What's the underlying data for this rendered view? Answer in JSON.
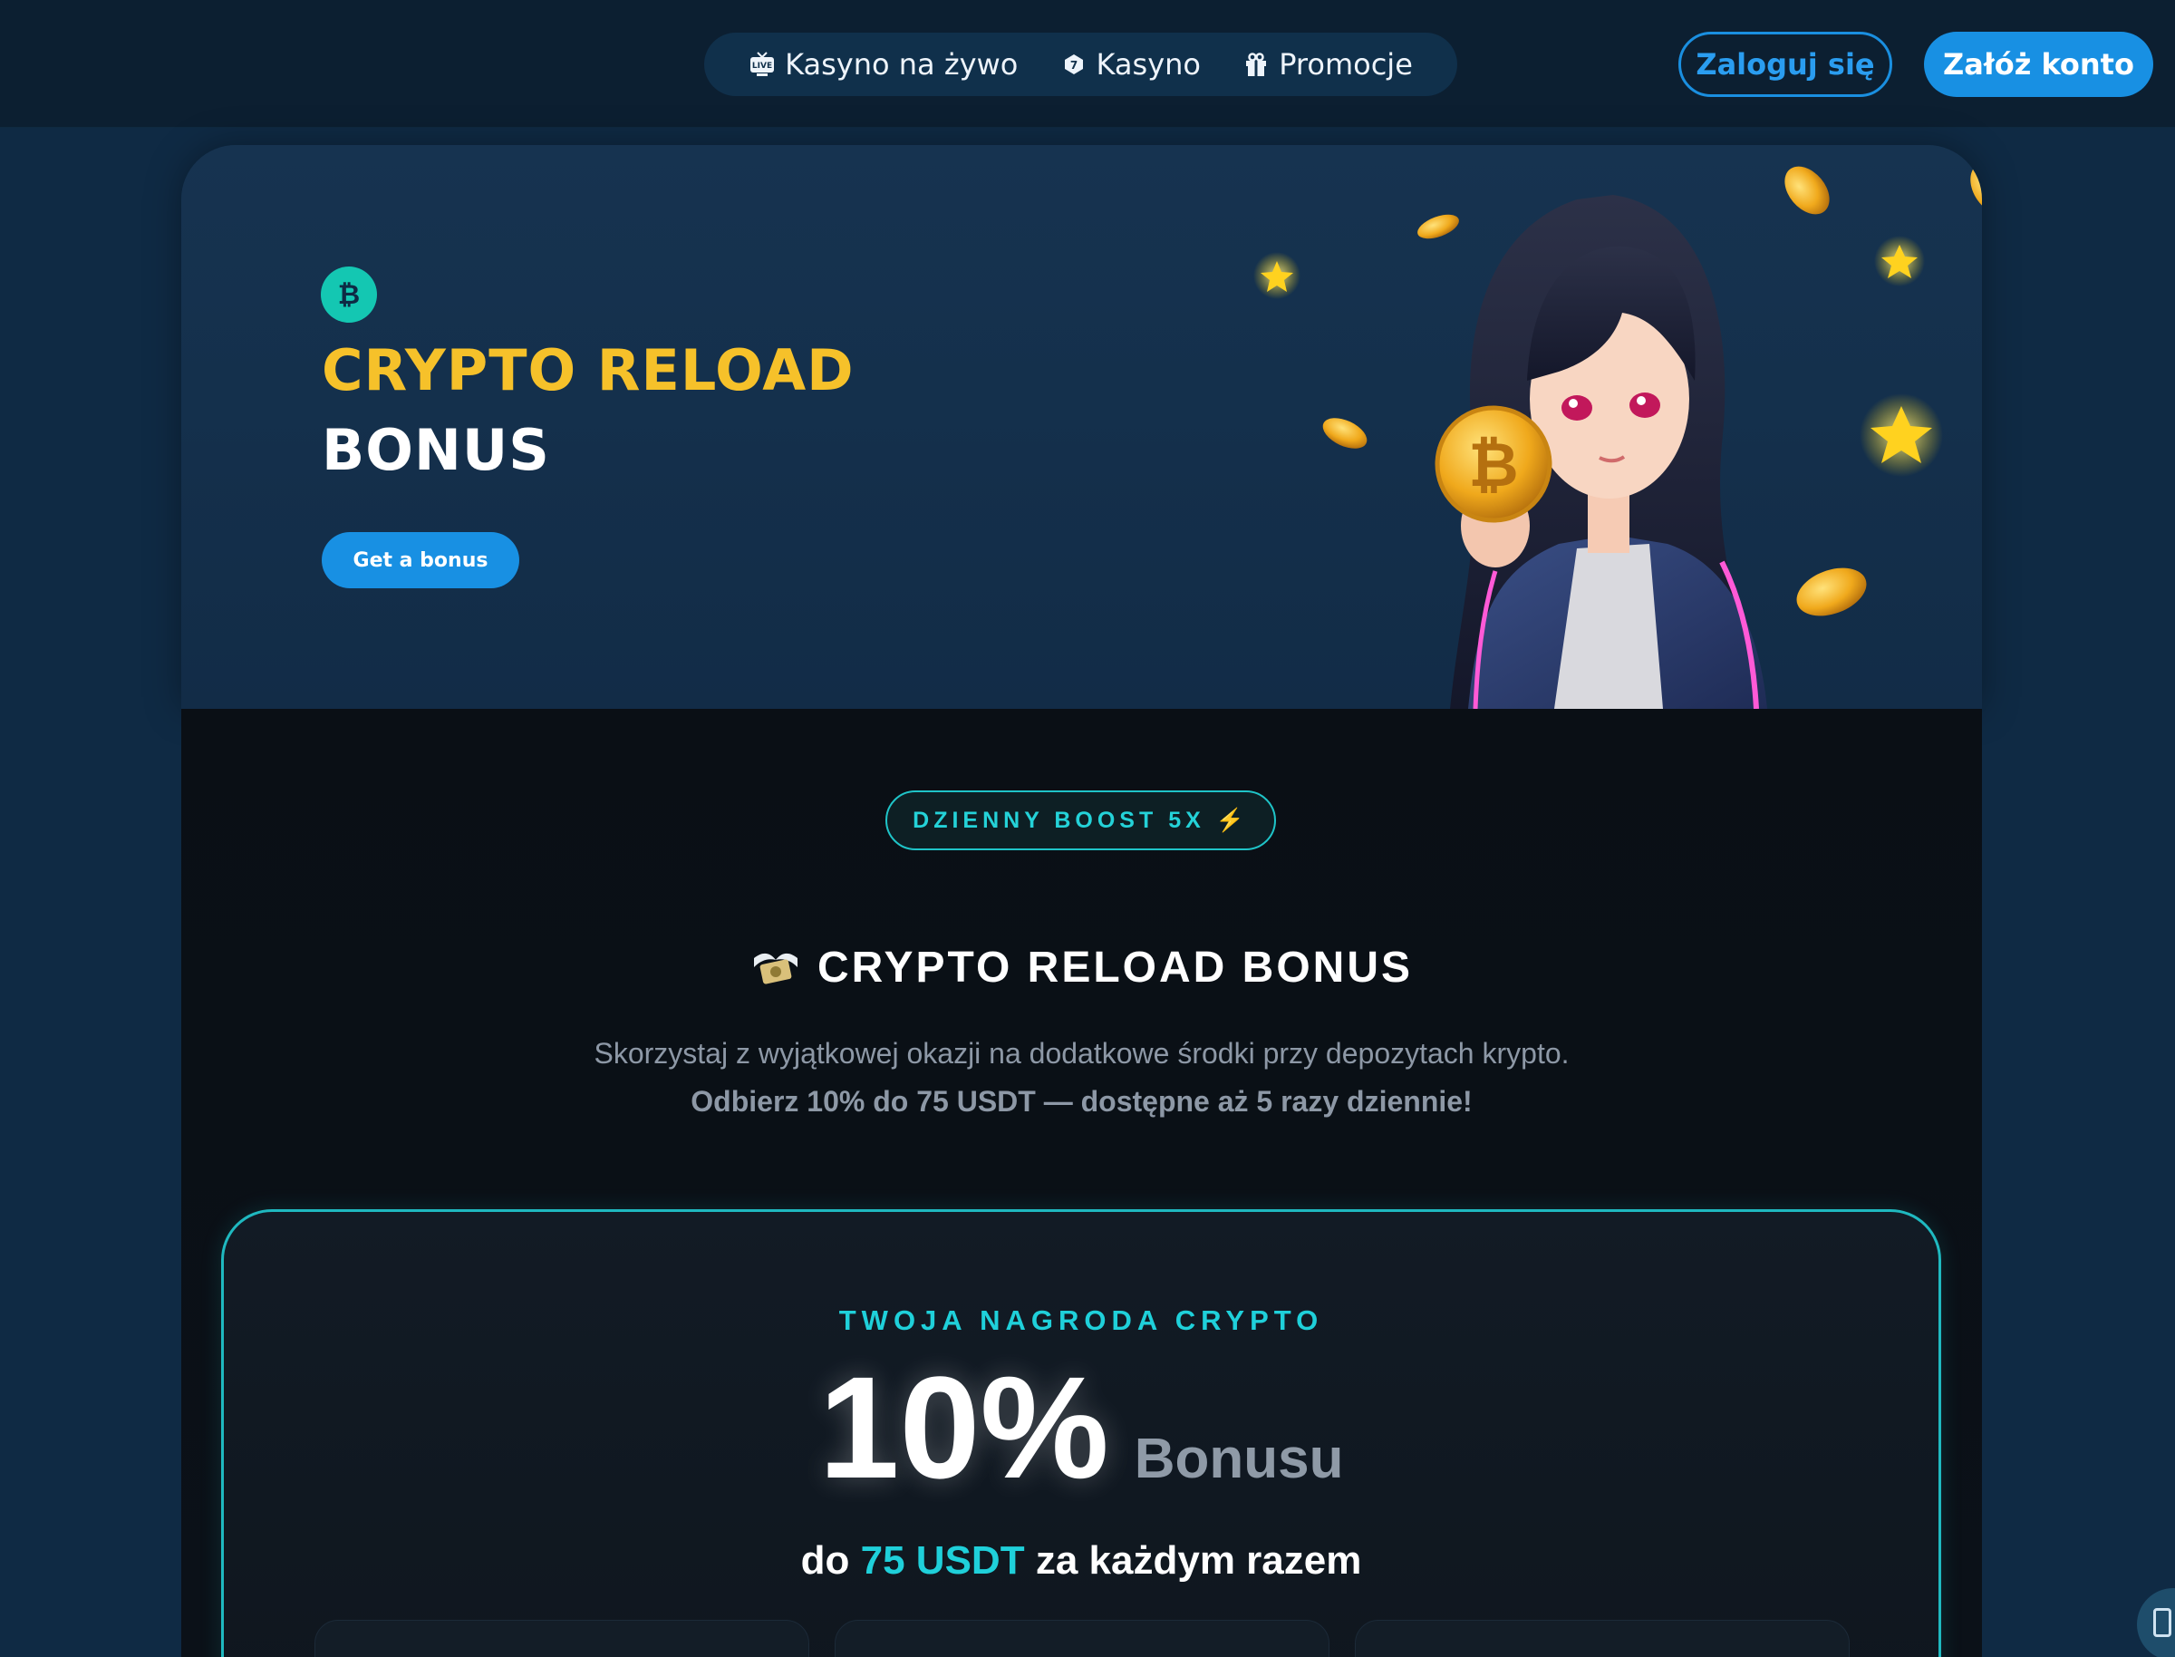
{
  "header": {
    "nav": [
      {
        "label": "Kasyno na żywo",
        "icon": "live-tv-icon"
      },
      {
        "label": "Kasyno",
        "icon": "slot-icon"
      },
      {
        "label": "Promocje",
        "icon": "gift-icon"
      }
    ],
    "login_label": "Zaloguj się",
    "register_label": "Załóż konto"
  },
  "hero": {
    "badge_icon": "bitcoin-icon",
    "title_line1": "CRYPTO RELOAD",
    "title_line2": "BONUS",
    "cta_label": "Get a bonus",
    "coin_symbol": "₿"
  },
  "main": {
    "pill_label": "DZIENNY BOOST 5X ⚡",
    "title": "CRYPTO RELOAD BONUS",
    "title_icon": "money-wings-icon",
    "description_line1": "Skorzystaj z wyjątkowej okazji na dodatkowe środki przy depozytach krypto.",
    "description_line2": "Odbierz 10% do 75 USDT — dostępne aż 5 razy dziennie!",
    "reward": {
      "eyebrow": "TWOJA NAGRODA CRYPTO",
      "percent": "10%",
      "unit": "Bonusu",
      "sub_prefix": "do",
      "sub_highlight": "75 USDT",
      "sub_suffix": "za każdym razem"
    }
  },
  "colors": {
    "accent_blue": "#1890e3",
    "accent_cyan": "#1fd0da",
    "hero_gold": "#f6c12a"
  }
}
